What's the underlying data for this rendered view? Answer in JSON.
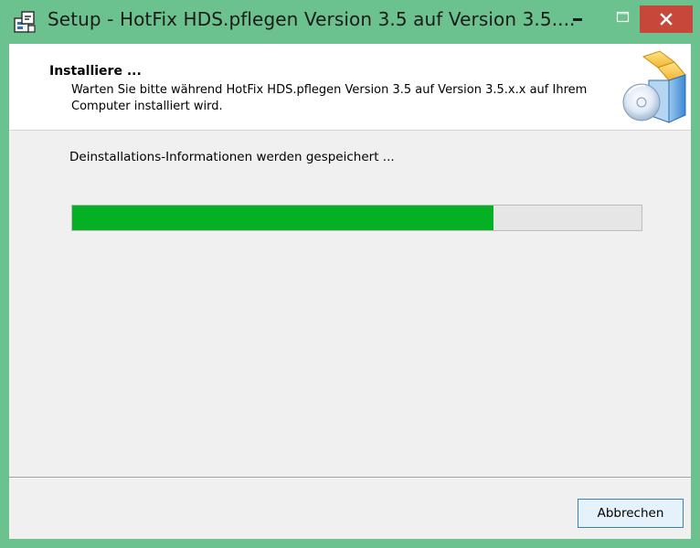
{
  "window": {
    "title": "Setup - HotFix HDS.pflegen Version 3.5 auf Version 3.5....",
    "frame_color": "#6cc28e",
    "close_button_color": "#c7473a"
  },
  "controls": {
    "minimize_icon": "minimize-icon",
    "maximize_icon": "maximize-icon",
    "close_icon": "close-icon"
  },
  "header": {
    "title": "Installiere ...",
    "description": "Warten Sie bitte während HotFix HDS.pflegen Version 3.5 auf Version 3.5.x.x auf Ihrem Computer installiert wird.",
    "graphic_icon": "setup-box-cd-icon"
  },
  "status": {
    "text": "Deinstallations-Informationen werden gespeichert ..."
  },
  "progress": {
    "value_percent": 74,
    "fill_color": "#06b025"
  },
  "buttons": {
    "cancel_label": "Abbrechen"
  }
}
